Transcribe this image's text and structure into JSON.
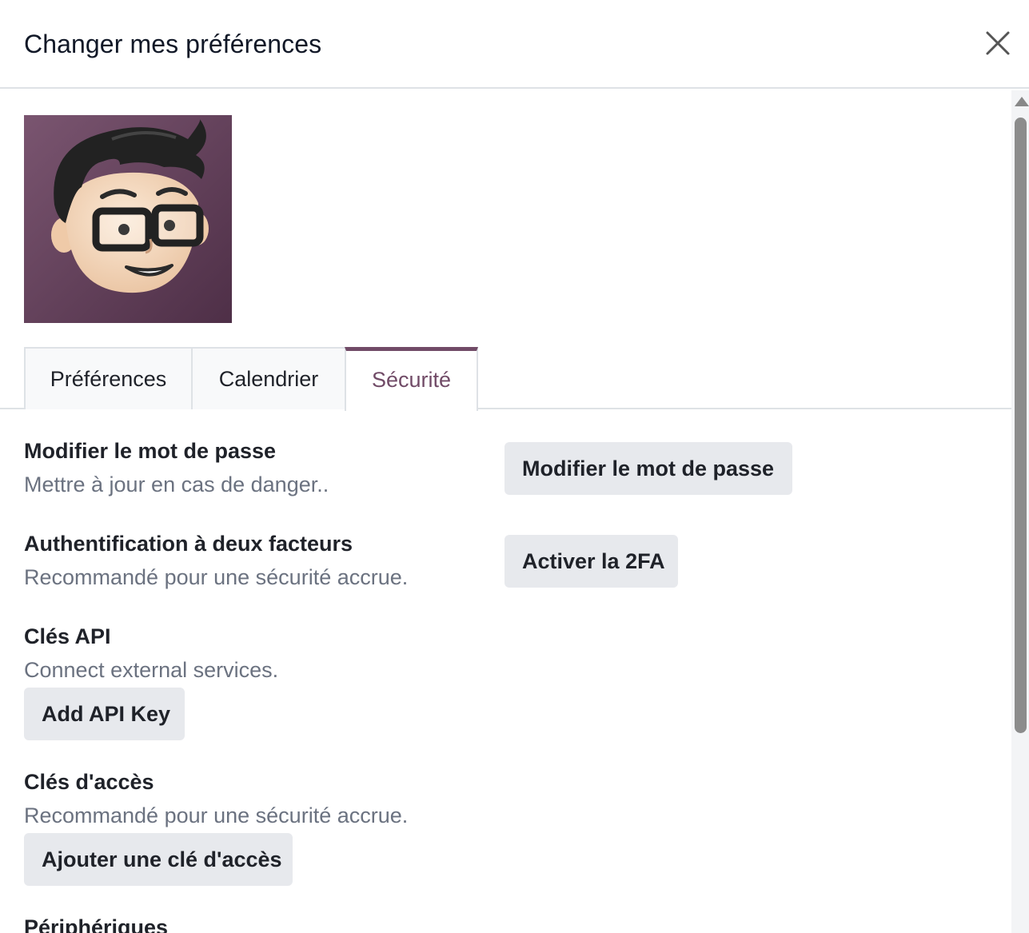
{
  "dialog": {
    "title": "Changer mes préférences"
  },
  "tabs": [
    {
      "label": "Préférences",
      "active": false
    },
    {
      "label": "Calendrier",
      "active": false
    },
    {
      "label": "Sécurité",
      "active": true
    }
  ],
  "security": {
    "password": {
      "title": "Modifier le mot de passe",
      "subtitle": "Mettre à jour en cas de danger..",
      "button": "Modifier le mot de passe"
    },
    "twofa": {
      "title": "Authentification à deux facteurs",
      "subtitle": "Recommandé pour une sécurité accrue.",
      "button": "Activer la 2FA"
    },
    "api_keys": {
      "title": "Clés API",
      "subtitle": "Connect external services.",
      "button": "Add API Key"
    },
    "passkeys": {
      "title": "Clés d'accès",
      "subtitle": "Recommandé pour une sécurité accrue.",
      "button": "Ajouter une clé d'accès"
    },
    "devices": {
      "title": "Périphériques"
    }
  },
  "colors": {
    "accent": "#714b67",
    "button_bg": "#e7e9ed",
    "muted_text": "#6b7280"
  }
}
